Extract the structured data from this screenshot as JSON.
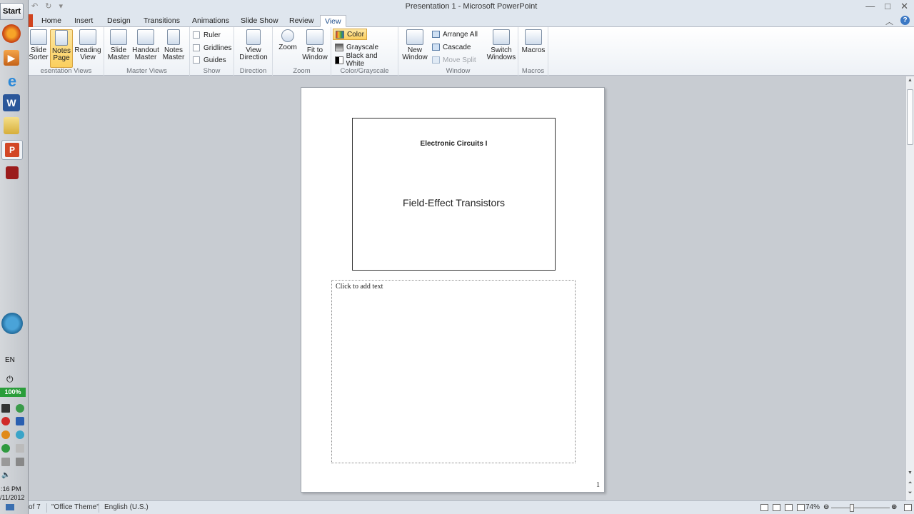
{
  "taskbar": {
    "start_label": "Start",
    "language": "EN",
    "battery": "100%",
    "clock_time": ":16 PM",
    "clock_date": "/11/2012",
    "icons": [
      "firefox-icon",
      "media-player-icon",
      "internet-explorer-icon",
      "word-icon",
      "folder-icon",
      "powerpoint-icon",
      "tool-icon"
    ]
  },
  "window": {
    "title": "Presentation 1  -  Microsoft PowerPoint"
  },
  "tabs": [
    {
      "label": "Home"
    },
    {
      "label": "Insert"
    },
    {
      "label": "Design"
    },
    {
      "label": "Transitions"
    },
    {
      "label": "Animations"
    },
    {
      "label": "Slide Show"
    },
    {
      "label": "Review"
    },
    {
      "label": "View"
    }
  ],
  "ribbon": {
    "presentation_views": {
      "label": "esentation Views",
      "slide_sorter": "Slide Sorter",
      "notes_page": "Notes Page",
      "reading_view": "Reading View"
    },
    "master_views": {
      "label": "Master Views",
      "slide_master": "Slide Master",
      "handout_master": "Handout Master",
      "notes_master": "Notes Master"
    },
    "show": {
      "label": "Show",
      "ruler": "Ruler",
      "gridlines": "Gridlines",
      "guides": "Guides"
    },
    "direction": {
      "label": "Direction",
      "view_direction": "View Direction"
    },
    "zoom": {
      "label": "Zoom",
      "zoom": "Zoom",
      "fit_to_window": "Fit to Window"
    },
    "color_grayscale": {
      "label": "Color/Grayscale",
      "color": "Color",
      "grayscale": "Grayscale",
      "black_and_white": "Black and White"
    },
    "window": {
      "label": "Window",
      "new_window": "New Window",
      "arrange_all": "Arrange All",
      "cascade": "Cascade",
      "move_split": "Move Split",
      "switch_windows": "Switch Windows"
    },
    "macros": {
      "label": "Macros",
      "macros": "Macros"
    }
  },
  "page": {
    "slide_heading": "Electronic Circuits I",
    "slide_title": "Field-Effect Transistors",
    "notes_placeholder": "Click to add text",
    "page_number": "1"
  },
  "status": {
    "slide_of": "of 7",
    "theme": "\"Office Theme\"",
    "language": "English (U.S.)",
    "zoom_level": "74%"
  }
}
